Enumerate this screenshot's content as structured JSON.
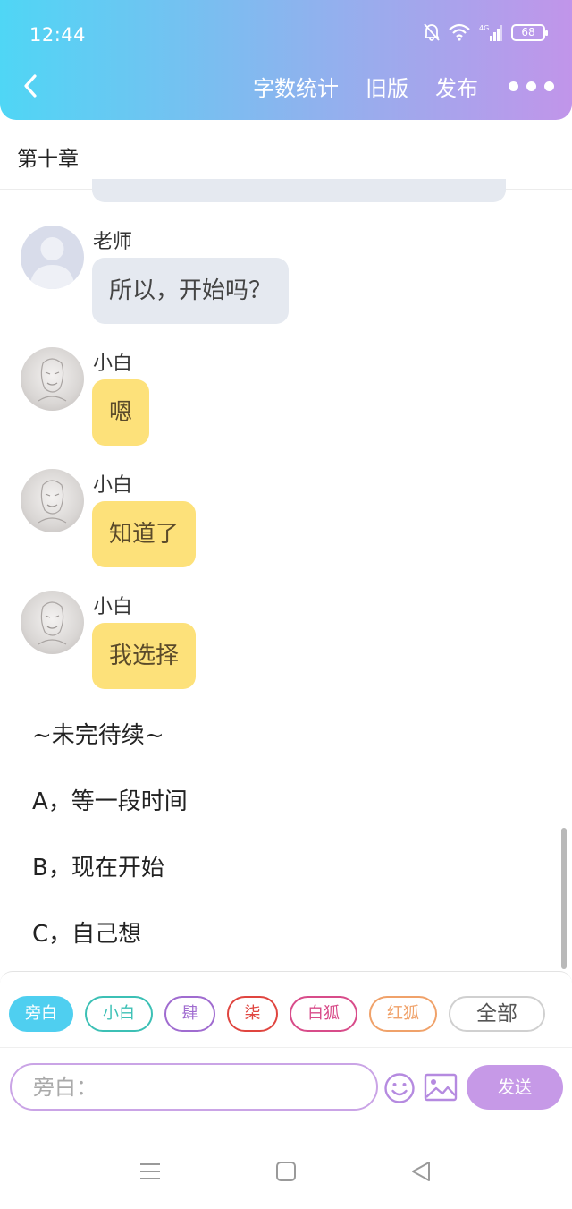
{
  "status_bar": {
    "time": "12:44",
    "battery": "68",
    "network": "4G"
  },
  "header": {
    "back_icon": "chevron-left-icon",
    "actions": [
      "字数统计",
      "旧版",
      "发布"
    ],
    "more_icon": "more-dots-icon",
    "gradient": [
      "#4fd6f5",
      "#c195ea"
    ]
  },
  "chapter": {
    "title": "第十章"
  },
  "messages": [
    {
      "sender": "老师",
      "text": "所以，开始吗？",
      "avatar": "teacher",
      "style": "grey"
    },
    {
      "sender": "小白",
      "text": "嗯",
      "avatar": "xiaobai",
      "style": "yellow"
    },
    {
      "sender": "小白",
      "text": "知道了",
      "avatar": "xiaobai",
      "style": "yellow"
    },
    {
      "sender": "小白",
      "text": "我选择",
      "avatar": "xiaobai",
      "style": "yellow"
    }
  ],
  "narration": [
    "~未完待续~",
    "A，等一段时间",
    "B，现在开始",
    "C，自己想"
  ],
  "composer": {
    "chips": [
      {
        "label": "旁白",
        "color": "#4fcff0",
        "active": true
      },
      {
        "label": "小白",
        "color": "#3cc0b5",
        "active": false
      },
      {
        "label": "肆",
        "color": "#a06cd0",
        "active": false
      },
      {
        "label": "柒",
        "color": "#e0453f",
        "active": false
      },
      {
        "label": "白狐",
        "color": "#d84c8a",
        "active": false
      },
      {
        "label": "红狐",
        "color": "#f0a26a",
        "active": false
      },
      {
        "label": "全部",
        "color": "#555555",
        "active": false
      }
    ],
    "input_placeholder": "旁白：",
    "send_label": "发送",
    "accent": "#c699e7"
  },
  "system_nav": [
    "menu-icon",
    "home-icon",
    "back-triangle-icon"
  ]
}
